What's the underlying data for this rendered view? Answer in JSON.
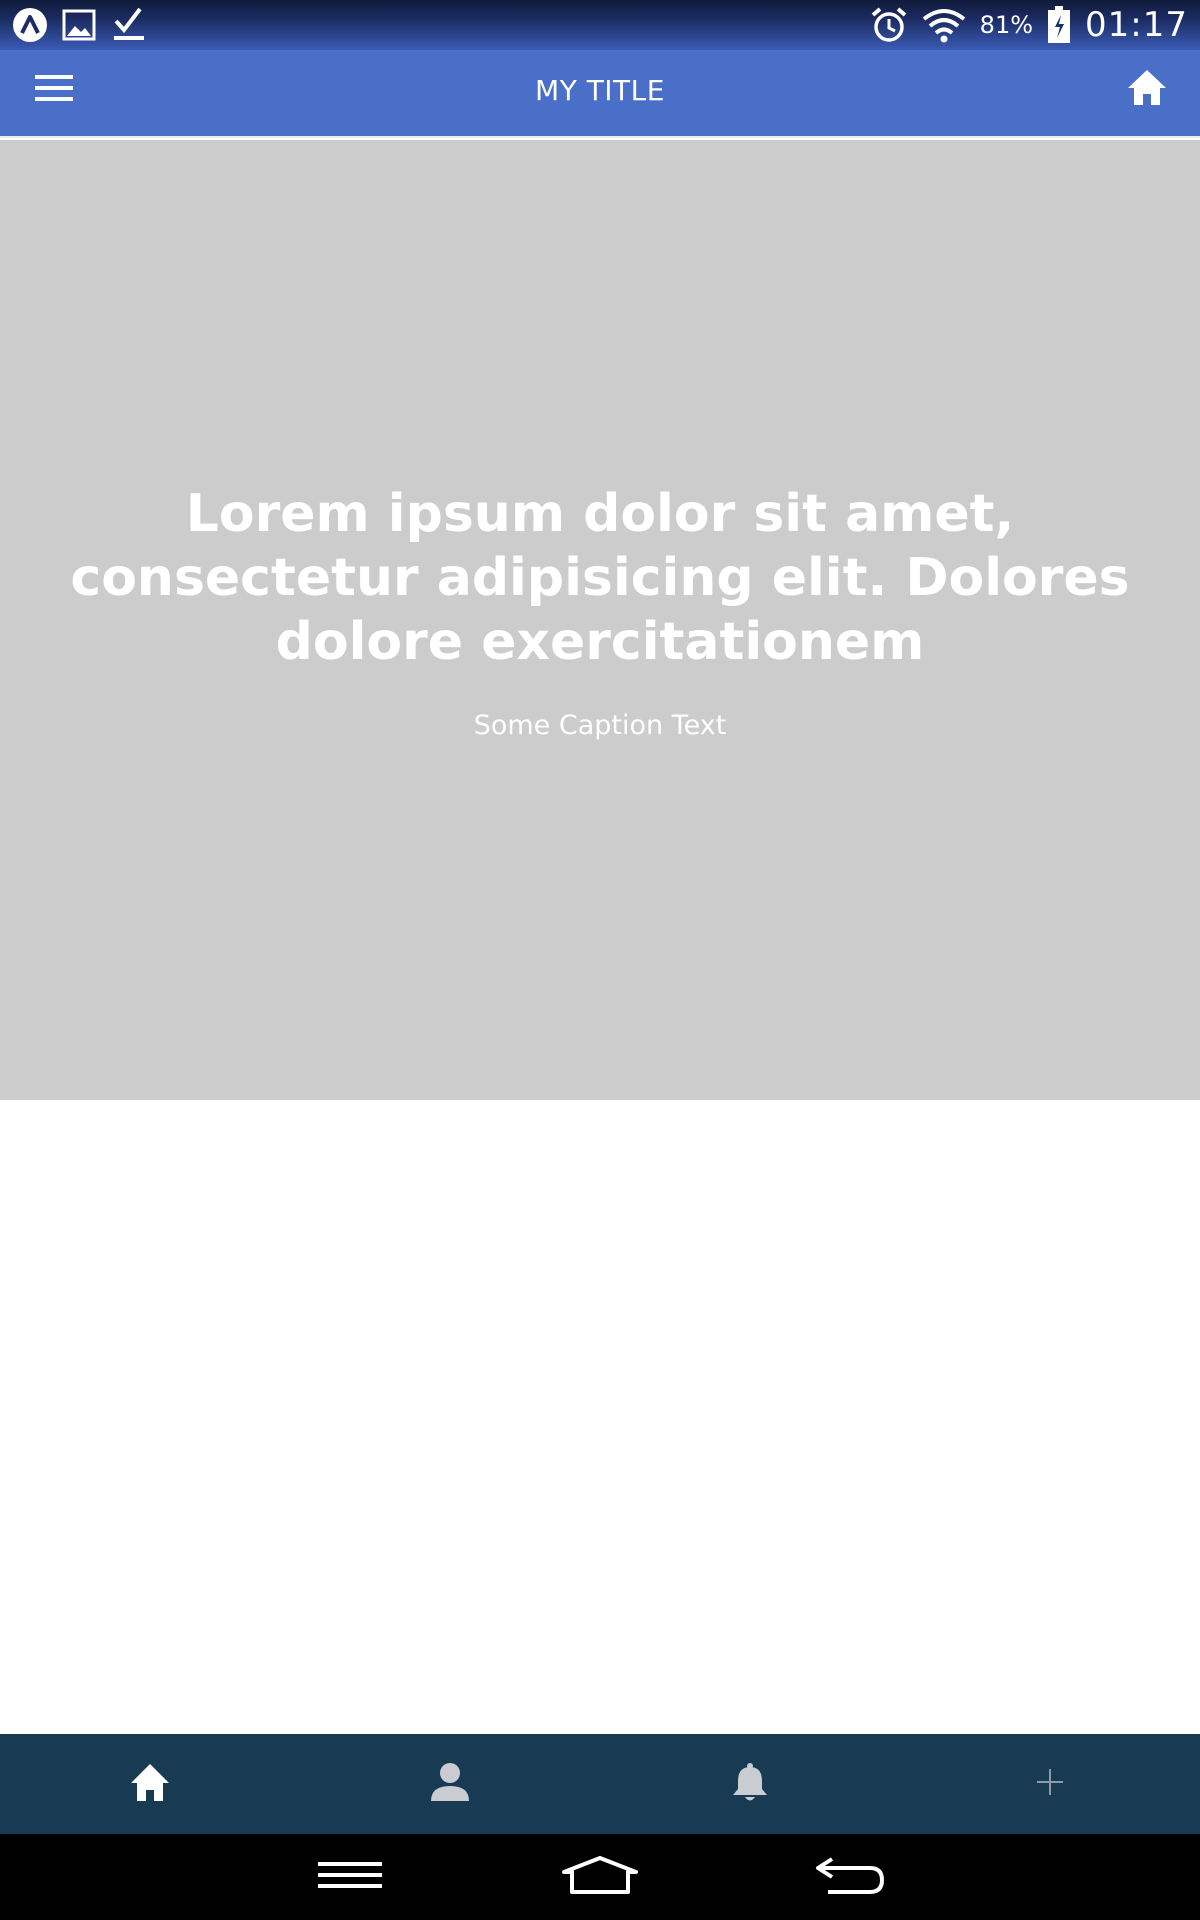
{
  "status_bar": {
    "icons_left": [
      "app-icon",
      "image-icon",
      "download-done-icon"
    ],
    "icons_right": [
      "alarm-icon",
      "wifi-icon",
      "battery-charging-icon"
    ],
    "battery_percent": "81%",
    "time": "01:17"
  },
  "app_bar": {
    "title": "MY TITLE",
    "menu_icon": "hamburger-menu-icon",
    "home_icon": "home-icon",
    "background": "#4a6fc8"
  },
  "hero": {
    "heading": "Lorem ipsum dolor sit amet, consectetur adipisicing elit. Dolores dolore exercitationem",
    "caption": "Some Caption Text",
    "background": "#cccccc"
  },
  "tabs": [
    {
      "icon": "home-icon",
      "active": true
    },
    {
      "icon": "person-icon",
      "active": false
    },
    {
      "icon": "bell-icon",
      "active": false
    },
    {
      "icon": "plus-icon",
      "active": false
    }
  ],
  "tab_bar_color": "#183a52",
  "system_nav": [
    "recent-apps-icon",
    "home-outline-icon",
    "back-icon"
  ]
}
